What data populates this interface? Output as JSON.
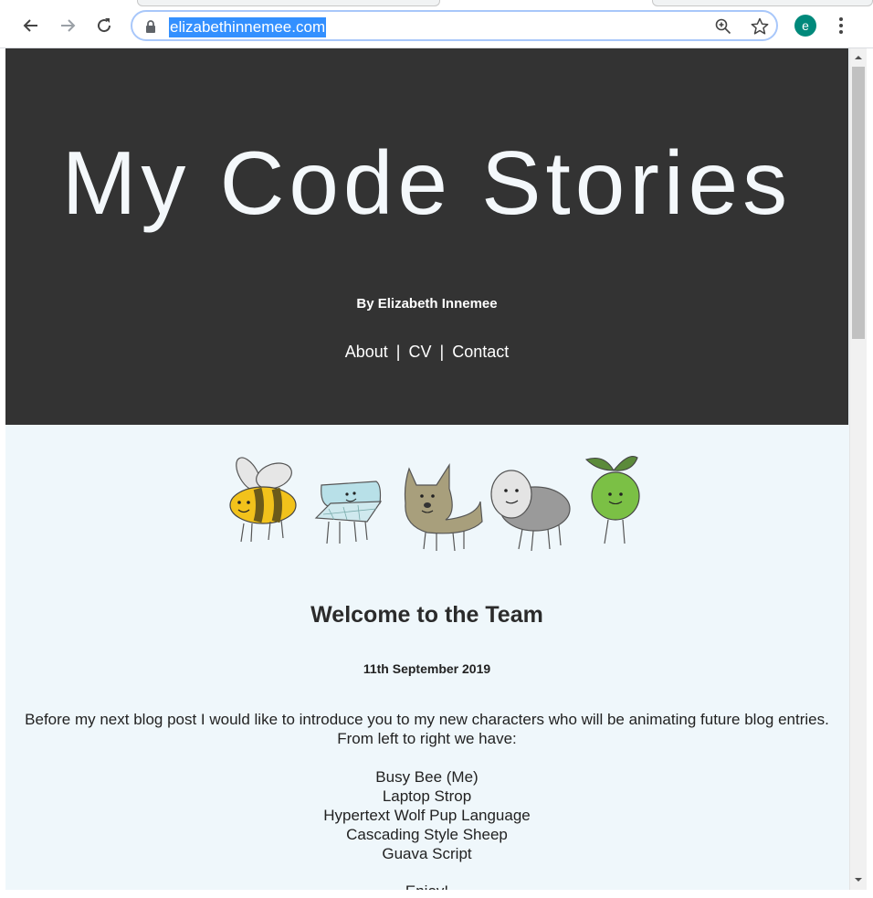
{
  "browser": {
    "url": "elizabethinnemee.com",
    "profile_initial": "e",
    "icons": [
      "back-arrow-icon",
      "forward-arrow-icon",
      "reload-icon",
      "lock-icon",
      "zoom-icon",
      "star-icon",
      "more-vert-icon"
    ]
  },
  "hero": {
    "title": "My Code Stories",
    "byline": "By Elizabeth Innemee",
    "nav": [
      {
        "label": "About"
      },
      {
        "label": "CV"
      },
      {
        "label": "Contact"
      }
    ],
    "nav_separator": "|",
    "background": "#333333"
  },
  "post": {
    "title": "Welcome to the Team",
    "date": "11th September 2019",
    "intro_line1": "Before my next blog post I would like to introduce you to my new characters who will be animating future blog entries.",
    "intro_line2": "From left to right we have:",
    "characters": [
      {
        "name": "Busy Bee (Me)"
      },
      {
        "name": "Laptop Strop"
      },
      {
        "name": "Hypertext Wolf Pup Language"
      },
      {
        "name": "Cascading Style Sheep"
      },
      {
        "name": "Guava Script"
      }
    ],
    "closing": "Enjoy!"
  },
  "colors": {
    "page_background": "#eff7fb",
    "url_highlight": "#3390ff",
    "profile": "#00897b"
  }
}
